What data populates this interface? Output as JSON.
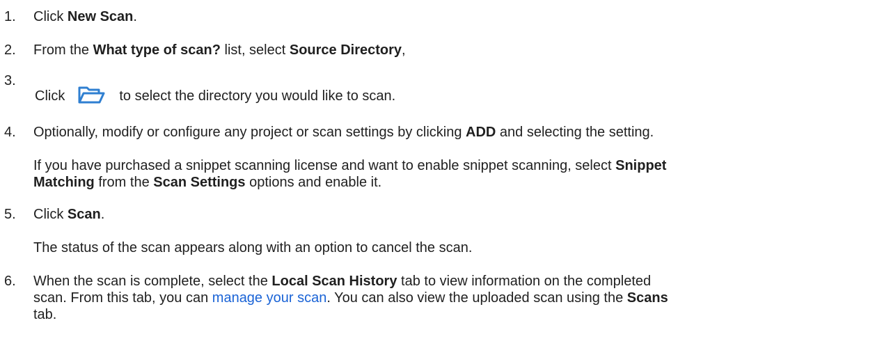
{
  "steps": [
    {
      "num": "1.",
      "parts": [
        "Click ",
        "New Scan",
        "."
      ]
    },
    {
      "num": "2.",
      "parts": [
        "From the ",
        "What type of scan?",
        " list, select ",
        "Source Directory",
        ","
      ]
    },
    {
      "num": "3.",
      "parts": [
        "Click",
        "to select the directory you would like to scan."
      ],
      "icon": "folder-open-icon",
      "icon_color": "#2f7fd1"
    },
    {
      "num": "4.",
      "parts": [
        "Optionally, modify or configure any project or scan settings by clicking ",
        "ADD",
        " and selecting the setting."
      ],
      "note": [
        "If you have purchased a snippet scanning license and want to enable snippet scanning, select ",
        "Snippet",
        "Matching",
        " from the ",
        "Scan Settings",
        " options and enable it."
      ]
    },
    {
      "num": "5.",
      "parts": [
        "Click ",
        "Scan",
        "."
      ],
      "note": [
        "The status of the scan appears along with an option to cancel the scan."
      ]
    },
    {
      "num": "6.",
      "parts": [
        "When the scan is complete, select the ",
        "Local Scan History",
        " tab to view information on the completed",
        "scan. From this tab, you can ",
        "manage your scan",
        ". You can also view the uploaded scan using the ",
        "Scans",
        "tab."
      ]
    }
  ],
  "colors": {
    "text": "#1f1f1f",
    "link": "#1a63d6",
    "icon": "#2f7fd1"
  }
}
